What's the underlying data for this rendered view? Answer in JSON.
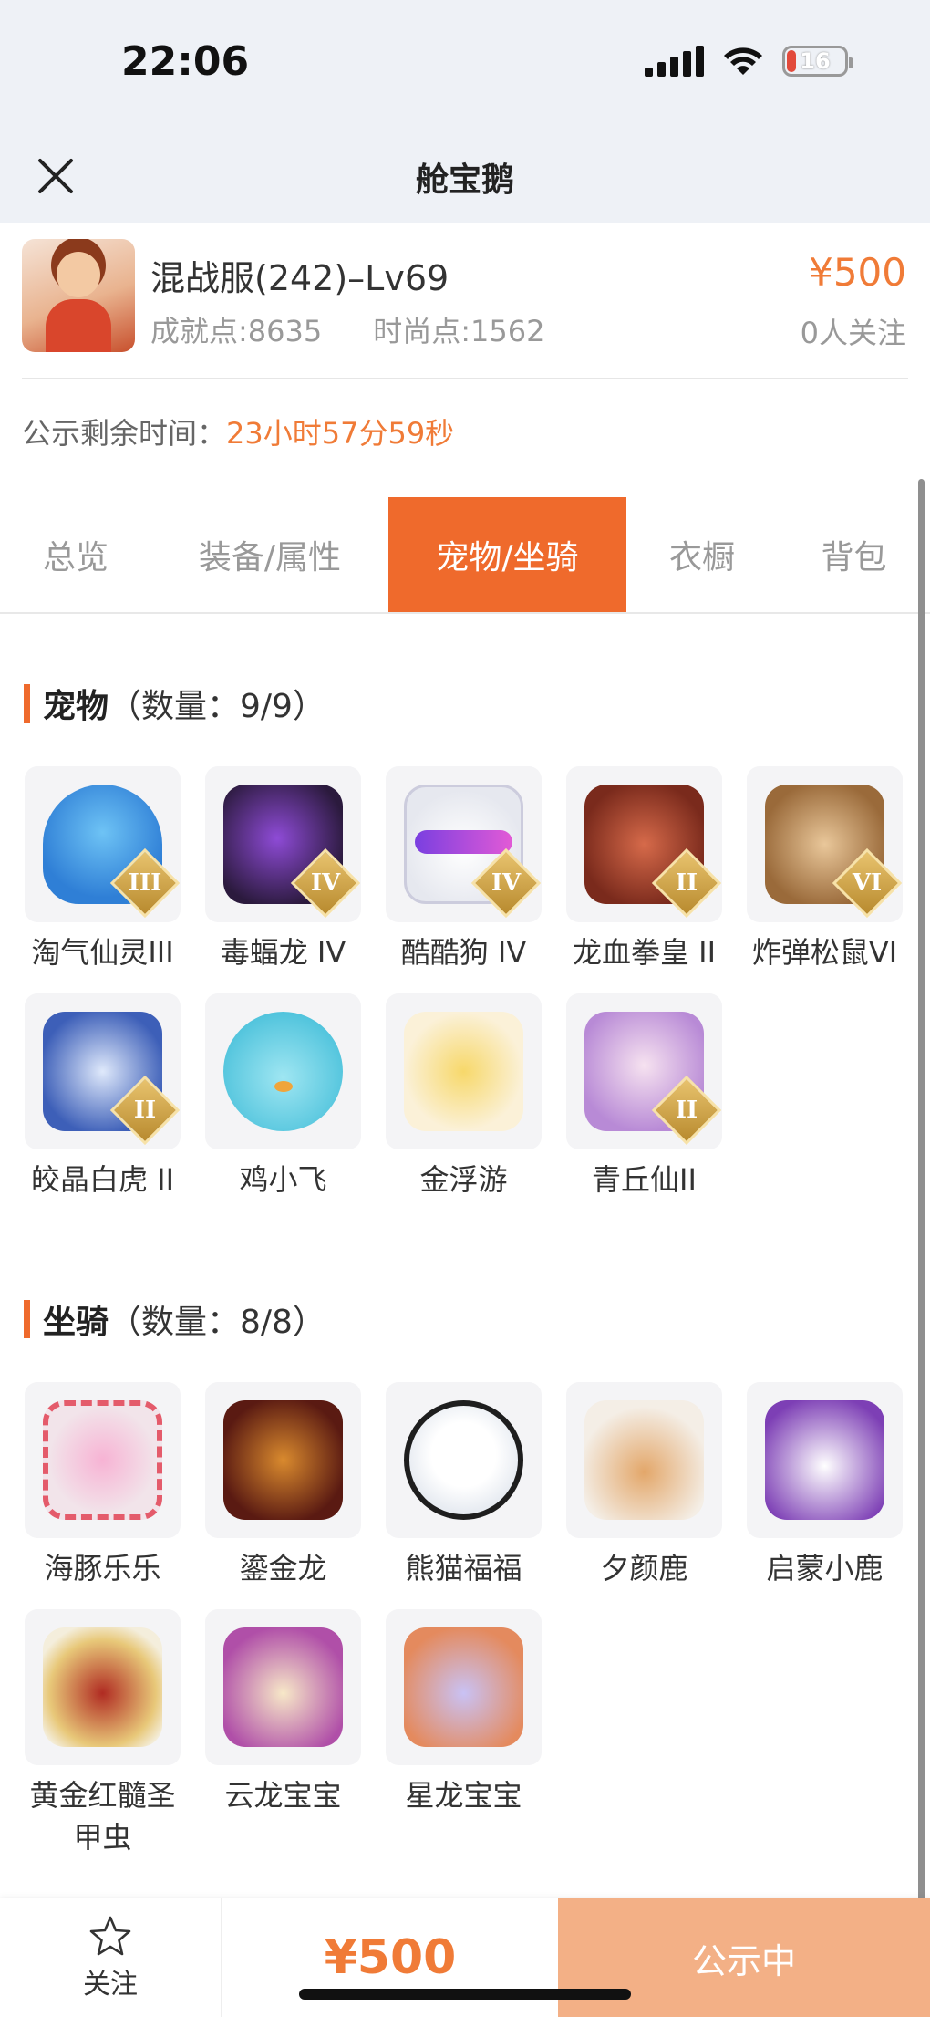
{
  "status_bar": {
    "time": "22:06",
    "battery": "16"
  },
  "nav": {
    "title": "舱宝鹅"
  },
  "listing": {
    "server_name": "混战服(242)–Lv69",
    "achievement": "成就点:8635",
    "fashion": "时尚点:1562",
    "price": "¥500",
    "followers": "0人关注",
    "countdown_label": "公示剩余时间：",
    "countdown_value": "23小时57分59秒"
  },
  "tabs": [
    {
      "label": "总览",
      "active": false
    },
    {
      "label": "装备/属性",
      "active": false
    },
    {
      "label": "宠物/坐骑",
      "active": true
    },
    {
      "label": "衣橱",
      "active": false
    },
    {
      "label": "背包",
      "active": false
    }
  ],
  "pets": {
    "title": "宠物",
    "count": "（数量：9/9）",
    "items": [
      {
        "name": "淘气仙灵III",
        "badge": "III",
        "icon": "blue-dog-icon"
      },
      {
        "name": "毒蝠龙 IV",
        "badge": "IV",
        "icon": "purple-dragon-icon"
      },
      {
        "name": "酷酷狗 IV",
        "badge": "IV",
        "icon": "white-dog-icon"
      },
      {
        "name": "龙血拳皇 II",
        "badge": "II",
        "icon": "red-beast-icon"
      },
      {
        "name": "炸弹松鼠VI",
        "badge": "VI",
        "icon": "squirrel-icon"
      },
      {
        "name": "皎晶白虎 II",
        "badge": "II",
        "icon": "white-tiger-icon"
      },
      {
        "name": "鸡小飞",
        "badge": "",
        "icon": "blue-chick-icon"
      },
      {
        "name": "金浮游",
        "badge": "",
        "icon": "golden-dragon-icon"
      },
      {
        "name": "青丘仙II",
        "badge": "II",
        "icon": "fox-fairy-icon"
      }
    ]
  },
  "mounts": {
    "title": "坐骑",
    "count": "（数量：8/8）",
    "items": [
      {
        "name": "海豚乐乐",
        "icon": "pink-dolphin-icon"
      },
      {
        "name": "鎏金龙",
        "icon": "gilded-dragon-icon"
      },
      {
        "name": "熊猫福福",
        "icon": "panda-icon"
      },
      {
        "name": "夕颜鹿",
        "icon": "deer-icon"
      },
      {
        "name": "启蒙小鹿",
        "icon": "white-fawn-icon"
      },
      {
        "name": "黄金红髓圣甲虫",
        "icon": "golden-beetle-icon"
      },
      {
        "name": "云龙宝宝",
        "icon": "cloud-dragon-icon"
      },
      {
        "name": "星龙宝宝",
        "icon": "star-dragon-icon"
      }
    ]
  },
  "bottom": {
    "follow_label": "关注",
    "price": "¥500",
    "status_button": "公示中"
  },
  "colors": {
    "accent": "#ef6a2c",
    "price": "#f07b37",
    "status_button": "#f3b086"
  }
}
